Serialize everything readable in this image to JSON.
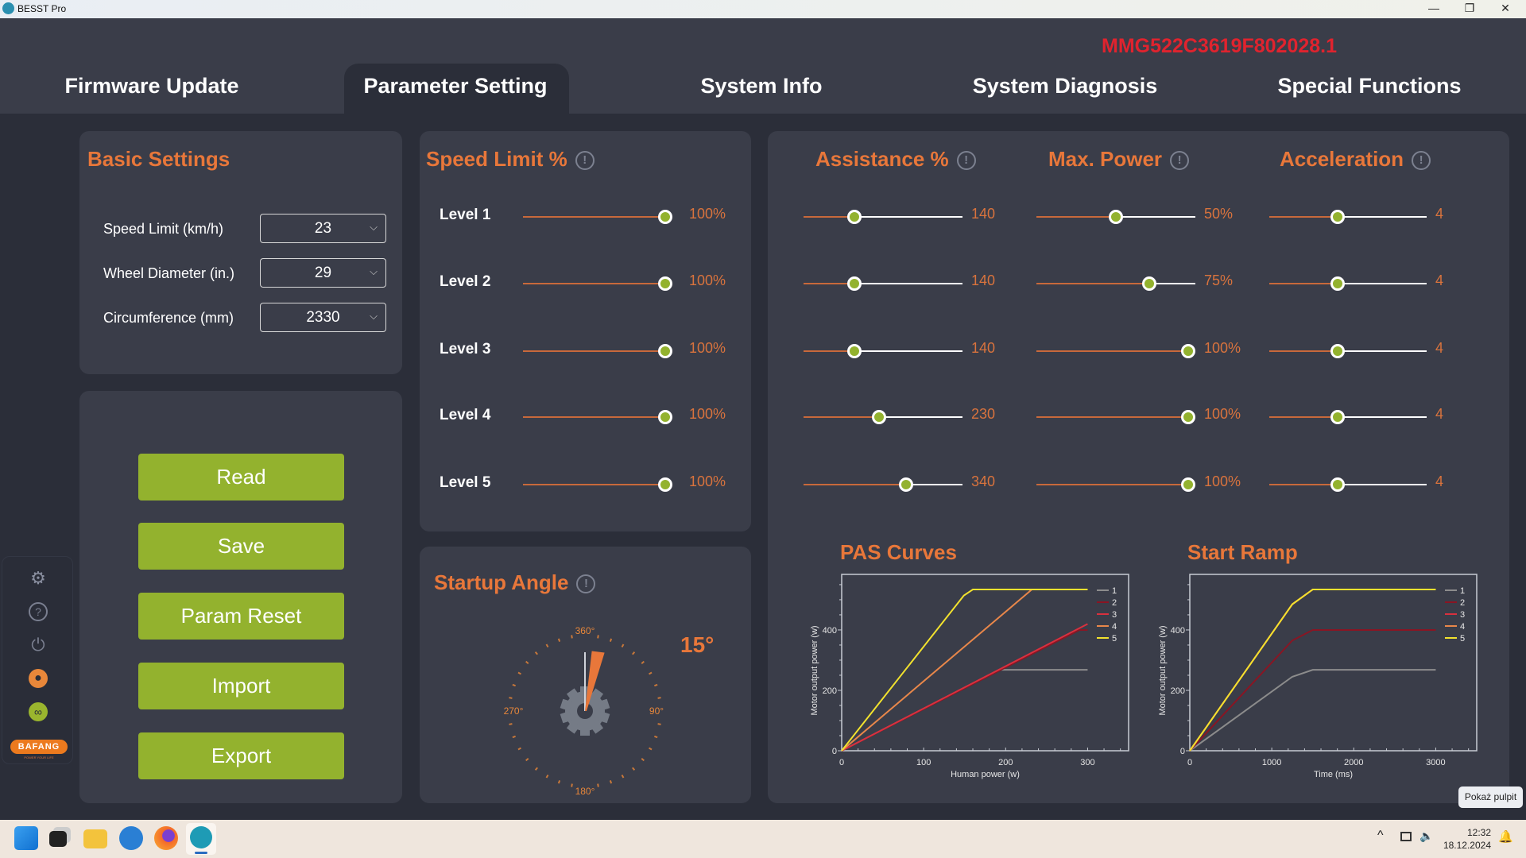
{
  "window": {
    "title": "BESST Pro",
    "controls": {
      "minimize": "—",
      "maximize": "❐",
      "close": "✕"
    }
  },
  "header": {
    "serial": "MMG522C3619F802028.1",
    "tabs": [
      {
        "label": "Firmware Update"
      },
      {
        "label": "Parameter Setting",
        "active": true
      },
      {
        "label": "System Info"
      },
      {
        "label": "System Diagnosis"
      },
      {
        "label": "Special Functions"
      }
    ]
  },
  "basic": {
    "title": "Basic Settings",
    "rows": [
      {
        "label": "Speed Limit (km/h)",
        "value": "23"
      },
      {
        "label": "Wheel Diameter (in.)",
        "value": "29"
      },
      {
        "label": "Circumference (mm)",
        "value": "2330"
      }
    ]
  },
  "actions": {
    "read": "Read",
    "save": "Save",
    "reset": "Param Reset",
    "import": "Import",
    "export": "Export"
  },
  "speed_limit": {
    "title": "Speed Limit %",
    "levels": [
      "Level 1",
      "Level 2",
      "Level 3",
      "Level 4",
      "Level 5"
    ],
    "values": [
      "100%",
      "100%",
      "100%",
      "100%",
      "100%"
    ],
    "fill": [
      1,
      1,
      1,
      1,
      1
    ]
  },
  "assistance": {
    "title": "Assistance %",
    "values": [
      "140",
      "140",
      "140",
      "230",
      "340"
    ],
    "fill": [
      0.3,
      0.3,
      0.3,
      0.47,
      0.66
    ]
  },
  "max_power": {
    "title": "Max. Power",
    "values": [
      "50%",
      "75%",
      "100%",
      "100%",
      "100%"
    ],
    "fill": [
      0.5,
      0.73,
      1,
      1,
      1
    ]
  },
  "acceleration": {
    "title": "Acceleration",
    "values": [
      "4",
      "4",
      "4",
      "4",
      "4"
    ],
    "fill": [
      0.43,
      0.43,
      0.43,
      0.43,
      0.43
    ]
  },
  "startup": {
    "title": "Startup Angle",
    "value": "15°",
    "angle": 15,
    "labels": {
      "top": "360°",
      "right": "90°",
      "bottom": "180°",
      "left": "270°"
    }
  },
  "info_icon": "!",
  "sidebar": {
    "icons": [
      "gear-icon",
      "help-icon",
      "power-icon",
      "user-icon",
      "link-icon"
    ],
    "logo": "BAFANG",
    "tagline": "POWER YOUR LIFE",
    "user_color": "#e8873a",
    "link_color": "#9ab52e"
  },
  "colors": {
    "accent": "#e8773a",
    "button": "#93b22e",
    "serial": "#e0232e"
  },
  "chart_data": [
    {
      "type": "line",
      "title": "PAS Curves",
      "xlabel": "Human power (w)",
      "ylabel": "Motor output power (w)",
      "xlim": [
        0,
        350
      ],
      "ylim": [
        0,
        584
      ],
      "xticks": [
        0,
        100,
        200,
        300
      ],
      "yticks": [
        0,
        200,
        400
      ],
      "legend": "top-right",
      "grid": false,
      "series": [
        {
          "name": "1",
          "color": "#8c8c8c",
          "points": [
            [
              0,
              0
            ],
            [
              192,
              268
            ],
            [
              300,
              268
            ]
          ]
        },
        {
          "name": "2",
          "color": "#8a1523",
          "points": [
            [
              0,
              0
            ],
            [
              290,
              400
            ],
            [
              300,
              400
            ]
          ]
        },
        {
          "name": "3",
          "color": "#d9303e",
          "points": [
            [
              0,
              0
            ],
            [
              300,
              420
            ]
          ]
        },
        {
          "name": "4",
          "color": "#e8874a",
          "points": [
            [
              0,
              0
            ],
            [
              232,
              534
            ],
            [
              300,
              534
            ]
          ]
        },
        {
          "name": "5",
          "color": "#f2e22e",
          "points": [
            [
              0,
              0
            ],
            [
              149,
              514
            ],
            [
              160,
              534
            ],
            [
              300,
              534
            ]
          ]
        }
      ]
    },
    {
      "type": "line",
      "title": "Start Ramp",
      "xlabel": "Time (ms)",
      "ylabel": "Motor output power (w)",
      "xlim": [
        0,
        3500
      ],
      "ylim": [
        0,
        584
      ],
      "xticks": [
        0,
        1000,
        2000,
        3000
      ],
      "yticks": [
        0,
        200,
        400
      ],
      "legend": "top-right",
      "grid": false,
      "series": [
        {
          "name": "1",
          "color": "#8c8c8c",
          "points": [
            [
              0,
              0
            ],
            [
              1250,
              245
            ],
            [
              1500,
              268
            ],
            [
              3000,
              268
            ]
          ]
        },
        {
          "name": "2",
          "color": "#8a1523",
          "points": [
            [
              0,
              0
            ],
            [
              1250,
              365
            ],
            [
              1500,
              400
            ],
            [
              3000,
              400
            ]
          ]
        },
        {
          "name": "3",
          "color": "#d9303e",
          "points": [
            [
              0,
              0
            ],
            [
              1250,
              485
            ],
            [
              1500,
              534
            ],
            [
              3000,
              534
            ]
          ]
        },
        {
          "name": "4",
          "color": "#e8874a",
          "points": [
            [
              0,
              0
            ],
            [
              1250,
              485
            ],
            [
              1500,
              534
            ],
            [
              3000,
              534
            ]
          ]
        },
        {
          "name": "5",
          "color": "#f2e22e",
          "points": [
            [
              0,
              0
            ],
            [
              1250,
              485
            ],
            [
              1500,
              534
            ],
            [
              3000,
              534
            ]
          ]
        }
      ]
    }
  ],
  "taskbar": {
    "apps": [
      "windows-start-icon",
      "task-view-icon",
      "file-explorer-icon",
      "thunderbird-icon",
      "firefox-icon",
      "besst-icon"
    ],
    "time": "12:32",
    "date": "18.12.2024",
    "tooltip": "Pokaż pulpit",
    "tray_chevron": "^"
  }
}
